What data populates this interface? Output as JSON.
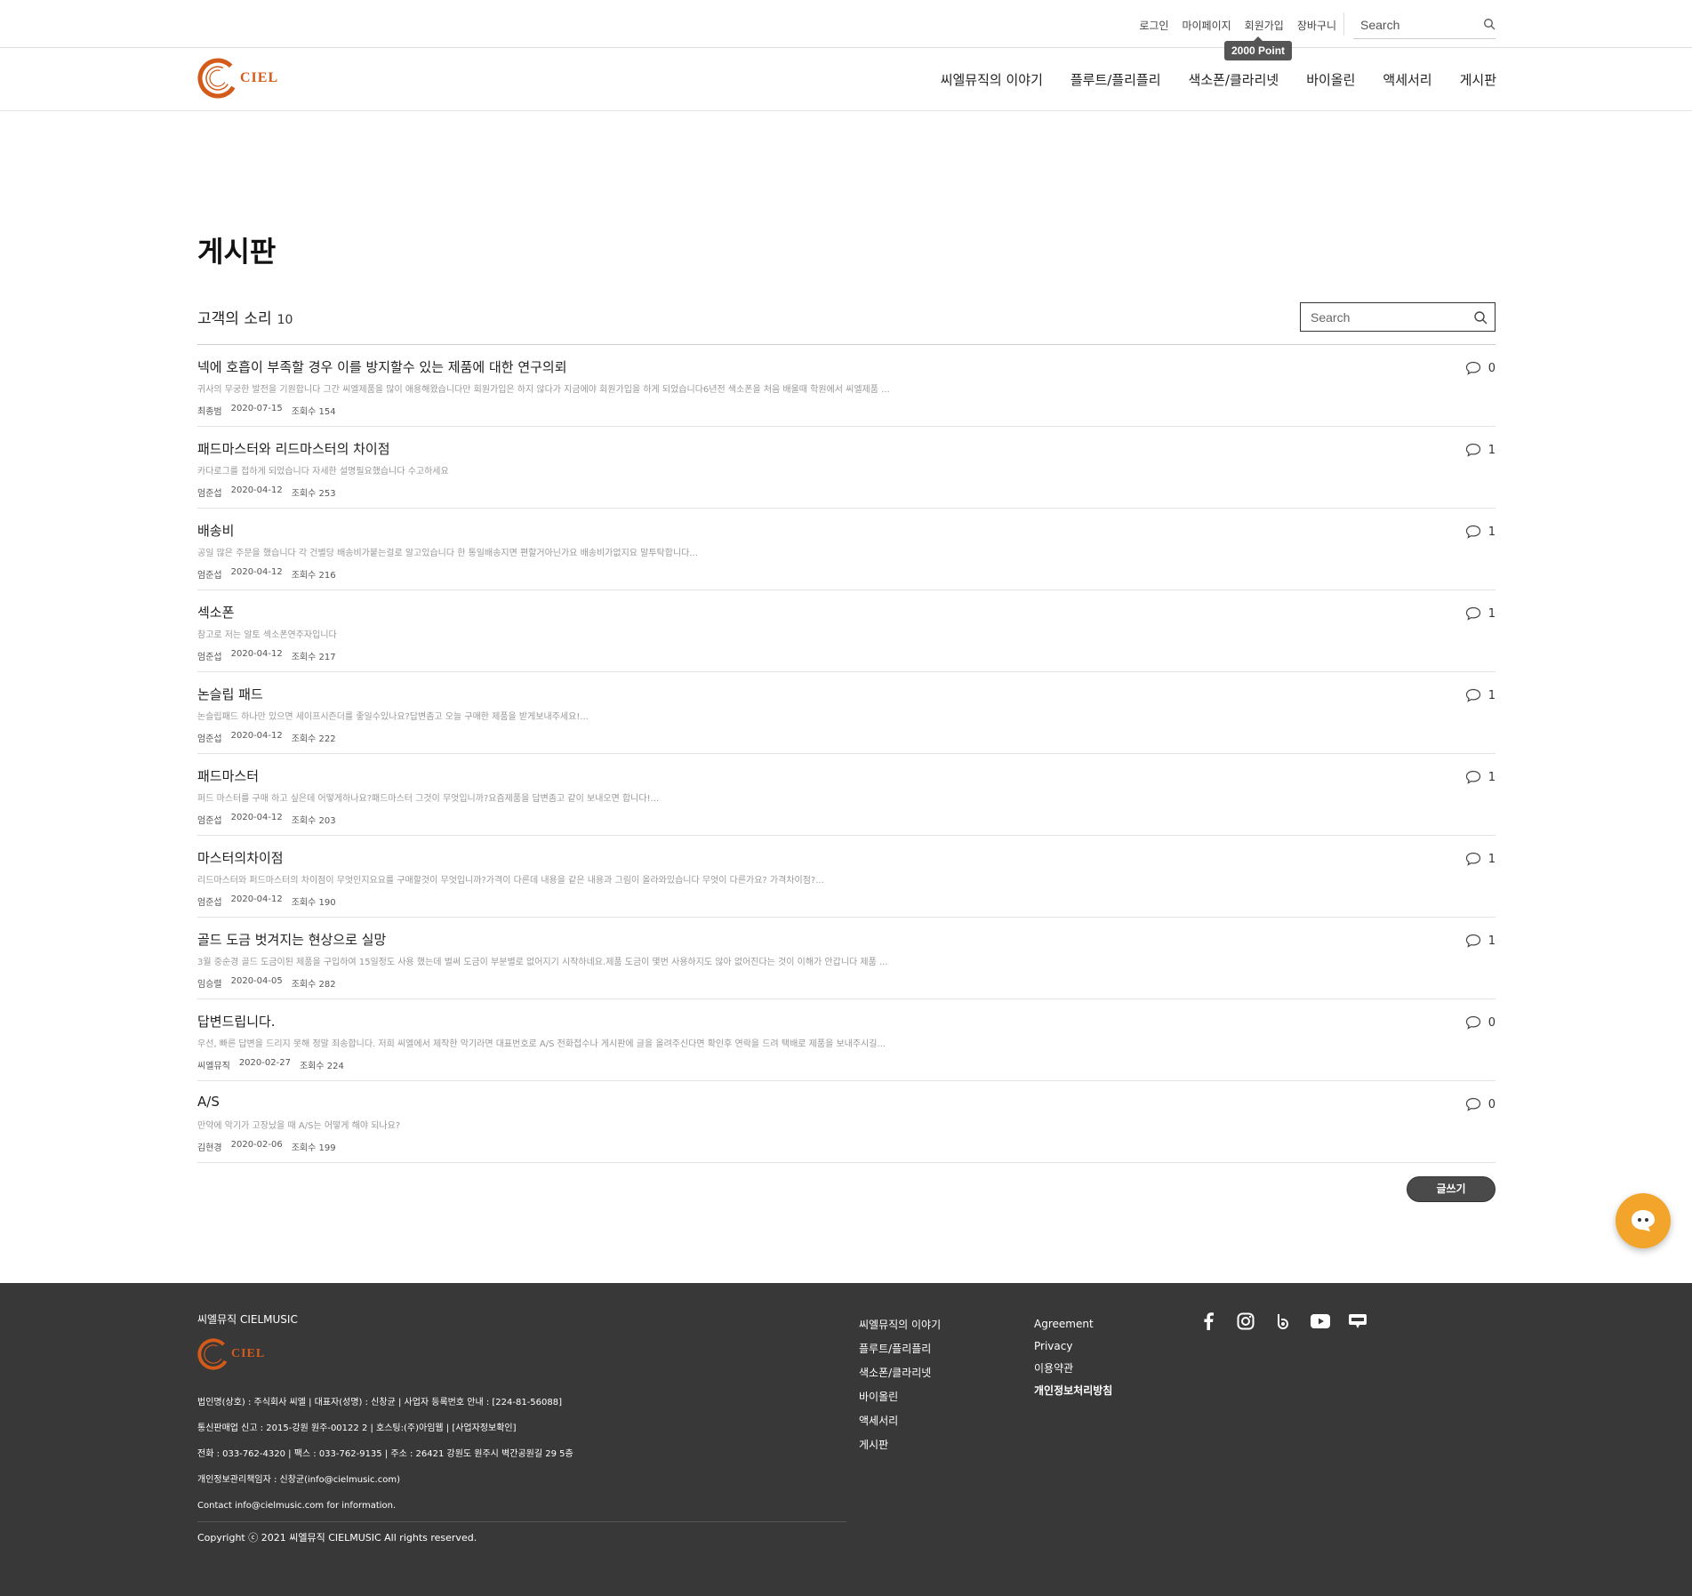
{
  "utility": {
    "links": [
      "로그인",
      "마이페이지",
      "회원가입",
      "장바구니"
    ],
    "search_placeholder": "Search",
    "point_tooltip": "2000 Point"
  },
  "brand": {
    "logo_text": "CIEL",
    "accent_color": "#d45a1a"
  },
  "nav": [
    "씨엘뮤직의 이야기",
    "플루트/플리플리",
    "색소폰/클라리넷",
    "바이올린",
    "액세서리",
    "게시판"
  ],
  "page": {
    "title": "게시판",
    "board_name": "고객의 소리",
    "board_count": "10",
    "search_placeholder": "Search",
    "write_button": "글쓰기"
  },
  "posts": [
    {
      "title": "넥에 호흡이 부족할 경우 이를 방지할수 있는 제품에 대한 연구의뢰",
      "excerpt": "귀사의 무궁한 발전을 기원합니다 그간 씨엘제품을 많이 애용해왔습니다만 회원가입은 하지 않다가 지금에야 회원가입을 하게 되었습니다6년전 색소폰을 처음 배울때 학원에서 씨엘제품 ...",
      "author": "최종범",
      "date": "2020-07-15",
      "views": "조회수 154",
      "comments": "0"
    },
    {
      "title": "패드마스터와 리드마스터의 차이점",
      "excerpt": "카다로그를 접하게 되었습니다 자세한 설명필요했습니다 수고하세요",
      "author": "엄준섭",
      "date": "2020-04-12",
      "views": "조회수 253",
      "comments": "1"
    },
    {
      "title": "배송비",
      "excerpt": "공일 많은 주문을 했습니다 각 건별당 배송비가붙는걸로 알고있습니다 한 통일배송지면 편할거아닌가요 배송비가없지요 말투탁합니다...",
      "author": "엄준섭",
      "date": "2020-04-12",
      "views": "조회수 216",
      "comments": "1"
    },
    {
      "title": "섹소폰",
      "excerpt": "참고로 저는 알토 섹소폰연주자입니다",
      "author": "엄준섭",
      "date": "2020-04-12",
      "views": "조회수 217",
      "comments": "1"
    },
    {
      "title": "논슬립   패드",
      "excerpt": "논슬립패드 하나만 있으면 세이프시즌더를 좋일수있나요?답변좀고 오늘 구매한 제품을 받게보내주세요!...",
      "author": "엄준섭",
      "date": "2020-04-12",
      "views": "조회수 222",
      "comments": "1"
    },
    {
      "title": "패드마스터",
      "excerpt": "퍼드 마스터를 구매 하고 싶은데 어떻게하나요?패드마스터 그것이 무엇입니까?요즘제품을 답변좀고 같이 보내오면 합니다!...",
      "author": "엄준섭",
      "date": "2020-04-12",
      "views": "조회수 203",
      "comments": "1"
    },
    {
      "title": "마스터의차이점",
      "excerpt": "리드마스터와 퍼드마스터의 차이점이 무엇인지요요를 구매할것이 무엇입니까?가격이 다른데 내용을 같은 내용과 그림이 올라와있습니다 무엇이 다른가요? 가격차이점?...",
      "author": "엄준섭",
      "date": "2020-04-12",
      "views": "조회수 190",
      "comments": "1"
    },
    {
      "title": "골드 도금 벗겨지는 현상으로 실망",
      "excerpt": "3월 중순경 골드 도금이된 제품을 구입하여 15일정도 사용 했는데 벌써 도금이 부분별로 없어지기 시작하네요.제품 도금이 몇번 사용하지도 않아 없어진다는 것이 이해가 안갑니다 제품 ...",
      "author": "임승렬",
      "date": "2020-04-05",
      "views": "조회수 282",
      "comments": "1"
    },
    {
      "title": "답변드립니다.",
      "excerpt": "우선, 빠른 답변을 드리지 못해 정말 죄송합니다. 저희 씨엘에서 제작한 악기라면 대표번호로 A/S 전화접수나 게시판에 글을 올려주신다면 확인후 연락을 드려 택배로 제품을 보내주시길...",
      "author": "씨엘뮤직",
      "date": "2020-02-27",
      "views": "조회수 224",
      "comments": "0"
    },
    {
      "title": "A/S",
      "excerpt": "만약에 악기가 고장났을 때 A/S는 어떻게 해야 되나요?",
      "author": "김현경",
      "date": "2020-02-06",
      "views": "조회수 199",
      "comments": "0"
    }
  ],
  "footer": {
    "brand": "씨엘뮤직 CIELMUSIC",
    "info": [
      "법인명(상호) : 주식회사 씨엘  |  대표자(성명) : 신창균 | 사업자 등록번호 안내 : [224-81-56088]",
      "통신판매업 신고 : 2015-강원 원주-00122 2 |  호스팅:(주)아임웹 |  [사업자정보확인]",
      "전화 : 033-762-4320  |  팩스 : 033-762-9135 | 주소 : 26421 강원도 원주시 벽간공원길 29 5층",
      "개인정보관리책임자 : 신창균(info@cielmusic.com)",
      "Contact info@cielmusic.com for information."
    ],
    "copyright": "Copyright ⓒ 2021 씨엘뮤직 CIELMUSIC All rights reserved.",
    "menu": [
      "씨엘뮤직의 이야기",
      "플루트/플리플리",
      "색소폰/클라리넷",
      "바이올린",
      "액세서리",
      "게시판"
    ],
    "policy": [
      "Agreement",
      "Privacy",
      "이용약관",
      "개인정보처리방침"
    ],
    "social_icons": [
      "facebook-icon",
      "instagram-icon",
      "band-icon",
      "youtube-icon",
      "blog-icon"
    ]
  }
}
